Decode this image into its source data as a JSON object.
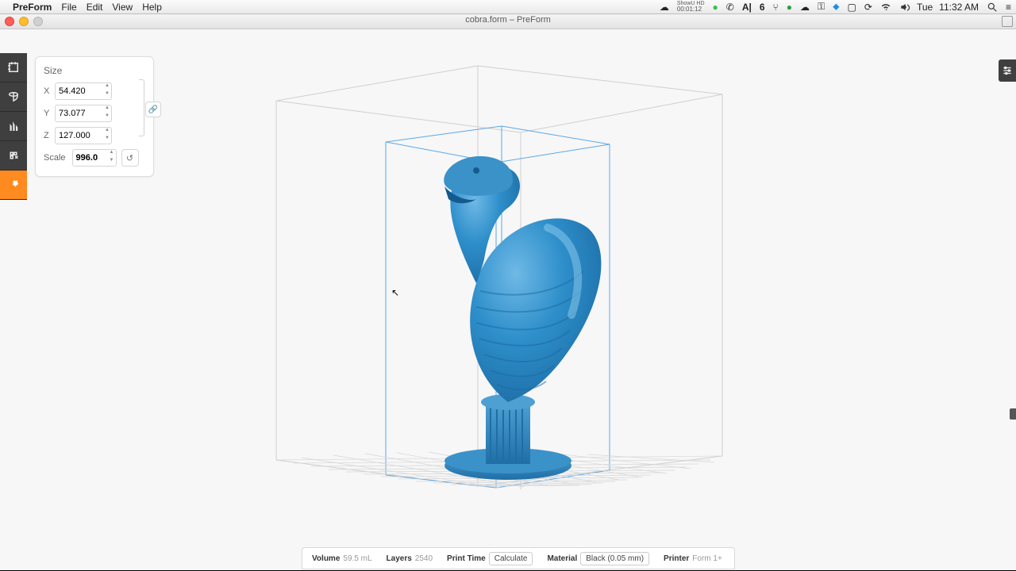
{
  "menubar": {
    "app_name": "PreForm",
    "menus": [
      "File",
      "Edit",
      "View",
      "Help"
    ],
    "right": {
      "badge_text": "6",
      "day": "Tue",
      "time": "11:32 AM",
      "timer": "00:01:12"
    }
  },
  "window": {
    "title": "cobra.form – PreForm"
  },
  "toolbox": {
    "items": [
      {
        "name": "size-tool",
        "active": false
      },
      {
        "name": "orient-tool",
        "active": false
      },
      {
        "name": "supports-tool",
        "active": false
      },
      {
        "name": "layout-tool",
        "active": false
      },
      {
        "name": "magic-tool",
        "active": true
      }
    ]
  },
  "size_panel": {
    "title": "Size",
    "x_label": "X",
    "x_value": "54.420",
    "y_label": "Y",
    "y_value": "73.077",
    "z_label": "Z",
    "z_value": "127.000",
    "scale_label": "Scale",
    "scale_value": "996.0",
    "reset_glyph": "↺",
    "link_glyph": "🔗"
  },
  "statusbar": {
    "volume_label": "Volume",
    "volume_value": "59.5 mL",
    "layers_label": "Layers",
    "layers_value": "2540",
    "printtime_label": "Print Time",
    "calculate_label": "Calculate",
    "material_label": "Material",
    "material_value": "Black (0.05 mm)",
    "printer_label": "Printer",
    "printer_value": "Form 1+"
  }
}
